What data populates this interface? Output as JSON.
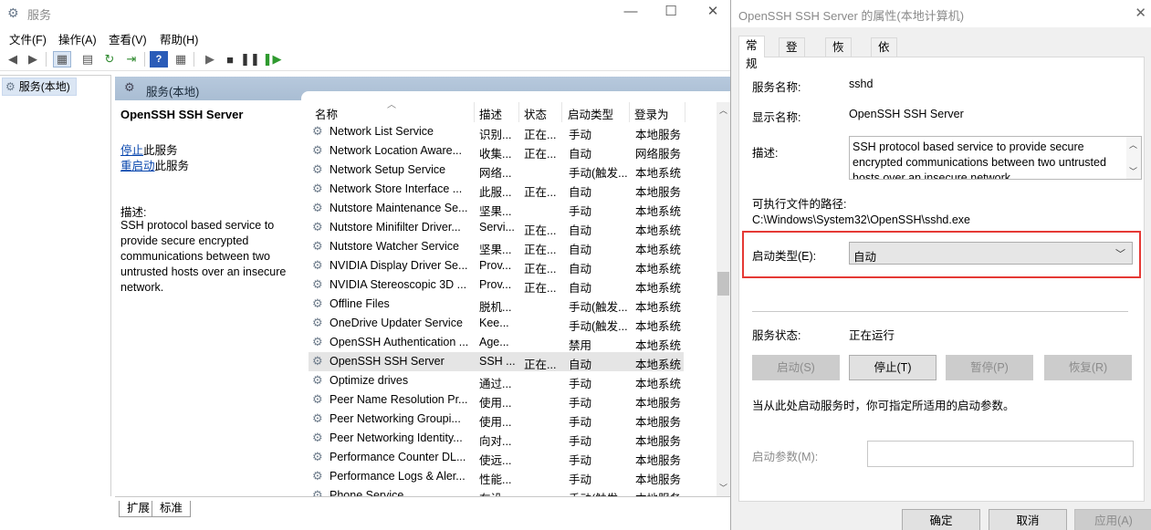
{
  "services_window": {
    "title": "服务",
    "menu": [
      "文件(F)",
      "操作(A)",
      "查看(V)",
      "帮助(H)"
    ],
    "tree_item": "服务(本地)",
    "content_header": "服务(本地)",
    "detail": {
      "service_title": "OpenSSH SSH Server",
      "stop_link": "停止",
      "stop_suffix": "此服务",
      "restart_link": "重启动",
      "restart_suffix": "此服务",
      "desc_label": "描述:",
      "desc_text": "SSH protocol based service to provide secure encrypted communications between two untrusted hosts over an insecure network."
    },
    "columns": [
      "名称",
      "描述",
      "状态",
      "启动类型",
      "登录为"
    ],
    "rows": [
      {
        "name": "Network List Service",
        "desc": "识别...",
        "status": "正在...",
        "startup": "手动",
        "logon": "本地服务"
      },
      {
        "name": "Network Location Aware...",
        "desc": "收集...",
        "status": "正在...",
        "startup": "自动",
        "logon": "网络服务"
      },
      {
        "name": "Network Setup Service",
        "desc": "网络...",
        "status": "",
        "startup": "手动(触发...",
        "logon": "本地系统"
      },
      {
        "name": "Network Store Interface ...",
        "desc": "此服...",
        "status": "正在...",
        "startup": "自动",
        "logon": "本地服务"
      },
      {
        "name": "Nutstore Maintenance Se...",
        "desc": "坚果...",
        "status": "",
        "startup": "手动",
        "logon": "本地系统"
      },
      {
        "name": "Nutstore Minifilter Driver...",
        "desc": "Servi...",
        "status": "正在...",
        "startup": "自动",
        "logon": "本地系统"
      },
      {
        "name": "Nutstore Watcher Service",
        "desc": "坚果...",
        "status": "正在...",
        "startup": "自动",
        "logon": "本地系统"
      },
      {
        "name": "NVIDIA Display Driver Se...",
        "desc": "Prov...",
        "status": "正在...",
        "startup": "自动",
        "logon": "本地系统"
      },
      {
        "name": "NVIDIA Stereoscopic 3D ...",
        "desc": "Prov...",
        "status": "正在...",
        "startup": "自动",
        "logon": "本地系统"
      },
      {
        "name": "Offline Files",
        "desc": "脱机...",
        "status": "",
        "startup": "手动(触发...",
        "logon": "本地系统"
      },
      {
        "name": "OneDrive Updater Service",
        "desc": "Kee...",
        "status": "",
        "startup": "手动(触发...",
        "logon": "本地系统"
      },
      {
        "name": "OpenSSH Authentication ...",
        "desc": "Age...",
        "status": "",
        "startup": "禁用",
        "logon": "本地系统"
      },
      {
        "name": "OpenSSH SSH Server",
        "desc": "SSH ...",
        "status": "正在...",
        "startup": "自动",
        "logon": "本地系统"
      },
      {
        "name": "Optimize drives",
        "desc": "通过...",
        "status": "",
        "startup": "手动",
        "logon": "本地系统"
      },
      {
        "name": "Peer Name Resolution Pr...",
        "desc": "使用...",
        "status": "",
        "startup": "手动",
        "logon": "本地服务"
      },
      {
        "name": "Peer Networking Groupi...",
        "desc": "使用...",
        "status": "",
        "startup": "手动",
        "logon": "本地服务"
      },
      {
        "name": "Peer Networking Identity...",
        "desc": "向对...",
        "status": "",
        "startup": "手动",
        "logon": "本地服务"
      },
      {
        "name": "Performance Counter DL...",
        "desc": "使远...",
        "status": "",
        "startup": "手动",
        "logon": "本地服务"
      },
      {
        "name": "Performance Logs & Aler...",
        "desc": "性能...",
        "status": "",
        "startup": "手动",
        "logon": "本地服务"
      },
      {
        "name": "Phone Service",
        "desc": "在设...",
        "status": "",
        "startup": "手动(触发...",
        "logon": "本地服务"
      }
    ],
    "bottom_tabs": [
      "扩展",
      "标准"
    ]
  },
  "dialog": {
    "title": "OpenSSH SSH Server 的属性(本地计算机)",
    "tabs": [
      "常规",
      "登录",
      "恢复",
      "依存关系"
    ],
    "service_name_label": "服务名称:",
    "service_name": "sshd",
    "display_name_label": "显示名称:",
    "display_name": "OpenSSH SSH Server",
    "description_label": "描述:",
    "description": "SSH protocol based service to provide secure encrypted communications between two untrusted hosts over an insecure network.",
    "exe_path_label": "可执行文件的路径:",
    "exe_path": "C:\\Windows\\System32\\OpenSSH\\sshd.exe",
    "startup_type_label": "启动类型(E):",
    "startup_type": "自动",
    "service_status_label": "服务状态:",
    "service_status": "正在运行",
    "buttons": {
      "start": "启动(S)",
      "stop": "停止(T)",
      "pause": "暂停(P)",
      "resume": "恢复(R)"
    },
    "hint": "当从此处启动服务时，你可指定所适用的启动参数。",
    "start_params_label": "启动参数(M):",
    "start_params_value": "",
    "footer": {
      "ok": "确定",
      "cancel": "取消",
      "apply": "应用(A)"
    }
  }
}
